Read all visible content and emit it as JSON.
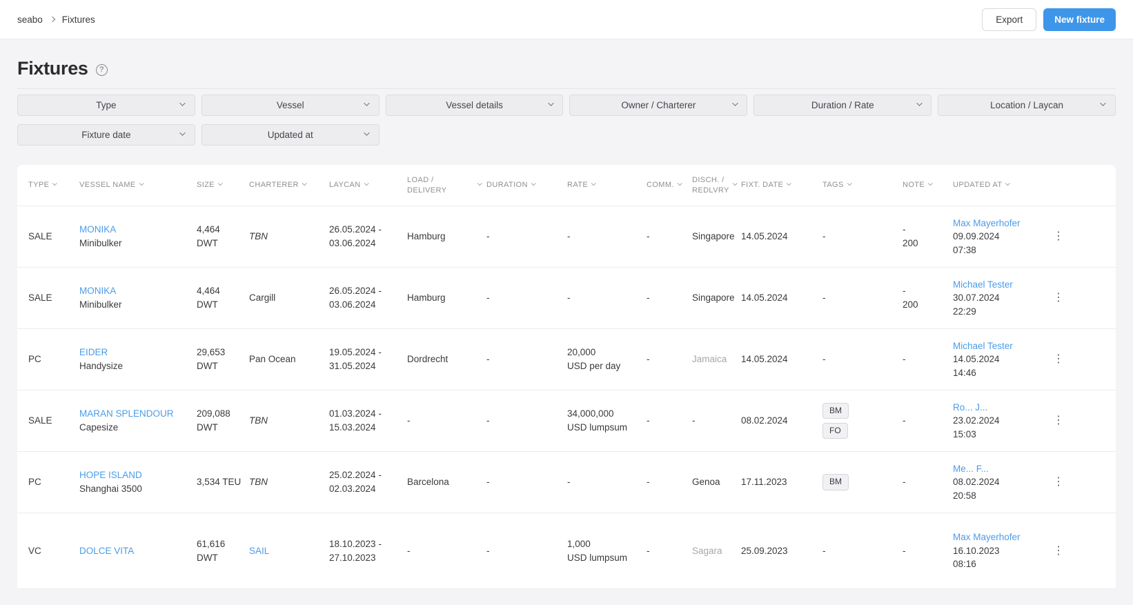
{
  "topbar": {
    "breadcrumb": [
      "seabo",
      "Fixtures"
    ],
    "export_label": "Export",
    "new_fixture_label": "New fixture"
  },
  "page": {
    "title": "Fixtures",
    "help_icon": "?"
  },
  "filters": {
    "row1": [
      "Type",
      "Vessel",
      "Vessel details",
      "Owner / Charterer",
      "Duration / Rate",
      "Location / Laycan"
    ],
    "row2": [
      "Fixture date",
      "Updated at"
    ]
  },
  "table": {
    "columns": [
      {
        "label": "TYPE"
      },
      {
        "label": "VESSEL NAME"
      },
      {
        "label": "SIZE"
      },
      {
        "label": "CHARTERER"
      },
      {
        "label": "LAYCAN",
        "sortable": true
      },
      {
        "label": "LOAD / DELIVERY"
      },
      {
        "label": "DURATION"
      },
      {
        "label": "RATE"
      },
      {
        "label": "COMM."
      },
      {
        "label": "DISCH. / REDLVRY"
      },
      {
        "label": "FIXT. DATE"
      },
      {
        "label": "TAGS"
      },
      {
        "label": "NOTE"
      },
      {
        "label": "UPDATED AT"
      }
    ],
    "rows": [
      {
        "type": "SALE",
        "vessel_name": "MONIKA",
        "vessel_class": "Minibulker",
        "size_line1": "4,464 DWT",
        "size_line2": "",
        "charterer": "TBN",
        "charterer_style": "italic",
        "laycan_line1": "26.05.2024 -",
        "laycan_line2": "03.06.2024",
        "load_delivery": "Hamburg",
        "duration": "-",
        "rate_line1": "-",
        "rate_line2": "",
        "comm": "-",
        "disch": "Singapore",
        "disch_muted": false,
        "fixt_date": "14.05.2024",
        "tags": [],
        "note_line1": "-",
        "note_line2": "200",
        "updated_by": "Max Mayerhofer",
        "updated_date": "09.09.2024",
        "updated_time": "07:38"
      },
      {
        "type": "SALE",
        "vessel_name": "MONIKA",
        "vessel_class": "Minibulker",
        "size_line1": "4,464 DWT",
        "size_line2": "",
        "charterer": "Cargill",
        "charterer_style": "normal",
        "laycan_line1": "26.05.2024 -",
        "laycan_line2": "03.06.2024",
        "load_delivery": "Hamburg",
        "duration": "-",
        "rate_line1": "-",
        "rate_line2": "",
        "comm": "-",
        "disch": "Singapore",
        "disch_muted": false,
        "fixt_date": "14.05.2024",
        "tags": [],
        "note_line1": "-",
        "note_line2": "200",
        "updated_by": "Michael Tester",
        "updated_date": "30.07.2024",
        "updated_time": "22:29"
      },
      {
        "type": "PC",
        "vessel_name": "EIDER",
        "vessel_class": "Handysize",
        "size_line1": "29,653",
        "size_line2": "DWT",
        "charterer": "Pan Ocean",
        "charterer_style": "normal",
        "laycan_line1": "19.05.2024 -",
        "laycan_line2": "31.05.2024",
        "load_delivery": "Dordrecht",
        "duration": "-",
        "rate_line1": "20,000",
        "rate_line2": "USD per day",
        "comm": "-",
        "disch": "Jamaica",
        "disch_muted": true,
        "fixt_date": "14.05.2024",
        "tags": [],
        "note_line1": "-",
        "note_line2": "",
        "updated_by": "Michael Tester",
        "updated_date": "14.05.2024",
        "updated_time": "14:46"
      },
      {
        "type": "SALE",
        "vessel_name": "MARAN SPLENDOUR",
        "vessel_class": "Capesize",
        "size_line1": "209,088",
        "size_line2": "DWT",
        "charterer": "TBN",
        "charterer_style": "italic",
        "laycan_line1": "01.03.2024 -",
        "laycan_line2": "15.03.2024",
        "load_delivery": "-",
        "duration": "-",
        "rate_line1": "34,000,000",
        "rate_line2": "USD lumpsum",
        "comm": "-",
        "disch": "-",
        "disch_muted": false,
        "fixt_date": "08.02.2024",
        "tags": [
          "BM",
          "FO"
        ],
        "note_line1": "-",
        "note_line2": "",
        "updated_by": "Ro... J...",
        "updated_date": "23.02.2024",
        "updated_time": "15:03"
      },
      {
        "type": "PC",
        "vessel_name": "HOPE ISLAND",
        "vessel_class": "Shanghai 3500",
        "size_line1": "3,534 TEU",
        "size_line2": "",
        "charterer": "TBN",
        "charterer_style": "italic",
        "laycan_line1": "25.02.2024 -",
        "laycan_line2": "02.03.2024",
        "load_delivery": "Barcelona",
        "duration": "-",
        "rate_line1": "-",
        "rate_line2": "",
        "comm": "-",
        "disch": "Genoa",
        "disch_muted": false,
        "fixt_date": "17.11.2023",
        "tags": [
          "BM"
        ],
        "note_line1": "-",
        "note_line2": "",
        "updated_by": "Me... F...",
        "updated_date": "08.02.2024",
        "updated_time": "20:58"
      },
      {
        "type": "VC",
        "vessel_name": "DOLCE VITA",
        "vessel_class": "",
        "size_line1": "61,616",
        "size_line2": "DWT",
        "charterer": "SAIL",
        "charterer_style": "link",
        "laycan_line1": "18.10.2023 -",
        "laycan_line2": "27.10.2023",
        "load_delivery": "-",
        "duration": "-",
        "rate_line1": "1,000",
        "rate_line2": "USD lumpsum",
        "comm": "-",
        "disch": "Sagara",
        "disch_muted": true,
        "fixt_date": "25.09.2023",
        "tags": [],
        "note_line1": "-",
        "note_line2": "",
        "updated_by": "Max Mayerhofer",
        "updated_date": "16.10.2023",
        "updated_time": "08:16"
      }
    ],
    "empty_value": "-"
  },
  "colors": {
    "accent_blue": "#3d96e9",
    "link_blue": "#4a9ce9",
    "muted_text": "#a6a6ac",
    "page_bg": "#f4f4f6",
    "tag_bg": "#f1f1f4"
  }
}
